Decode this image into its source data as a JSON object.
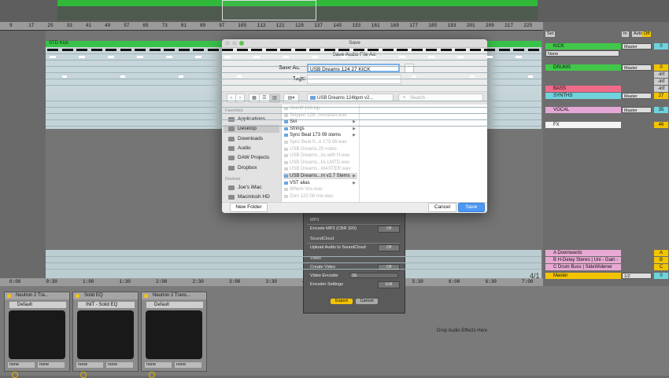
{
  "ruler": {
    "bars": [
      "9",
      "17",
      "25",
      "33",
      "41",
      "49",
      "57",
      "65",
      "73",
      "81",
      "89",
      "97",
      "105",
      "113",
      "121",
      "129",
      "137",
      "145",
      "153",
      "161",
      "169",
      "177",
      "185",
      "193",
      "201",
      "209",
      "217",
      "225"
    ]
  },
  "timeline": {
    "ticks": [
      "0:00",
      "0:30",
      "1:00",
      "1:30",
      "2:00",
      "2:30",
      "3:00",
      "3:30",
      "4:00",
      "4:30",
      "5:00",
      "5:30",
      "6:00",
      "6:30",
      "7:00"
    ],
    "bar_display": "4/1"
  },
  "arrangement": {
    "clip_label": "STD Kick"
  },
  "mixer": {
    "top_labels": {
      "set": "Set",
      "in": "In",
      "auto": "Auto",
      "off": "Off"
    },
    "tracks": [
      {
        "name": "KICK",
        "color": "#41c84a",
        "route": "Master",
        "value": "0",
        "sel": "None"
      },
      {
        "name": "DRUMS",
        "color": "#41c84a",
        "route": "Master",
        "value": "0"
      },
      {
        "name": "BASS",
        "color": "#f06a8a",
        "value": "21"
      },
      {
        "name": "SYNTHS",
        "color": "#6fd3dc",
        "route": "Master",
        "value": "27"
      },
      {
        "name": "VOCAL",
        "color": "#e4a7d6",
        "route": "Master",
        "value": "35"
      },
      {
        "name": "FX",
        "color": "#f3f3f3",
        "value": "46"
      }
    ],
    "returns": [
      {
        "name": "A Downwards",
        "value": "A"
      },
      {
        "name": "B H-Delay Stereo | Uni - Gain -Inf",
        "value": "B"
      },
      {
        "name": "C Drum Buss | SideWidener",
        "value": "C"
      },
      {
        "name": "Master",
        "route": "1/2",
        "value": "0"
      }
    ],
    "mini_vals": [
      "-inf",
      "-inf",
      "-inf"
    ]
  },
  "dialog": {
    "title": "Save",
    "heading": "Save Audio File As:",
    "save_as_label": "Save As:",
    "save_as_value": "USB Dreams 124 27 KICK",
    "tags_label": "Tags:",
    "location": "USB Dreams 124bpm v2...",
    "search_placeholder": "Search",
    "favorites_label": "Favorites",
    "devices_label": "Devices",
    "favorites": [
      "Applications",
      "Desktop",
      "Downloads",
      "Audio",
      "DAW Projects",
      "Dropbox"
    ],
    "devices": [
      "Joe's iMac",
      "Macintosh HD"
    ],
    "files": [
      {
        "name": "Sheriff 128.zip",
        "dir": false
      },
      {
        "name": "Skipper 126...remaster.wav",
        "dir": false
      },
      {
        "name": "SM",
        "dir": true
      },
      {
        "name": "Strings",
        "dir": true
      },
      {
        "name": "Sync Beat 173 09 stems",
        "dir": true
      },
      {
        "name": "Sync Beat fr...k 173 06.wav",
        "dir": false
      },
      {
        "name": "USB Dreams 25 notes",
        "dir": false
      },
      {
        "name": "USB Dreams...ks with H.wav",
        "dir": false
      },
      {
        "name": "USB Dreams...ks LMTD.wav",
        "dir": false
      },
      {
        "name": "USB Dreams...MASTER.wav",
        "dir": false
      },
      {
        "name": "USB Dreams...m v2.7 Stems",
        "dir": true
      },
      {
        "name": "VST alias",
        "dir": true
      },
      {
        "name": "Where Vox.wav",
        "dir": false
      },
      {
        "name": "Zom 122 08 mix.wav",
        "dir": false
      }
    ],
    "new_folder": "New Folder",
    "cancel": "Cancel",
    "save": "Save"
  },
  "export": {
    "mp3_section": "MP3",
    "mp3_label": "Encode MP3 (CBR 320)",
    "mp3_value": "Off",
    "sc_section": "SoundCloud",
    "sc_label": "Upload Audio to SoundCloud",
    "sc_value": "Off",
    "video_section": "Video",
    "create_video_label": "Create Video",
    "create_video_value": "Off",
    "encoder_label": "Video Encoder",
    "encoder_value": "3G",
    "encoder_settings_label": "Encoder Settings",
    "encoder_settings_value": "Edit",
    "export_btn": "Export",
    "cancel_btn": "Cancel"
  },
  "devices": [
    {
      "name": "Neutron 2 Tra...",
      "preset": "Default"
    },
    {
      "name": "Solid EQ",
      "preset": "INIT - Solid EQ"
    },
    {
      "name": "Neutron 2 Trans...",
      "preset": "Default"
    }
  ],
  "device_foot": [
    "none",
    "none"
  ],
  "drop_text": "Drop Audio Effects Here"
}
